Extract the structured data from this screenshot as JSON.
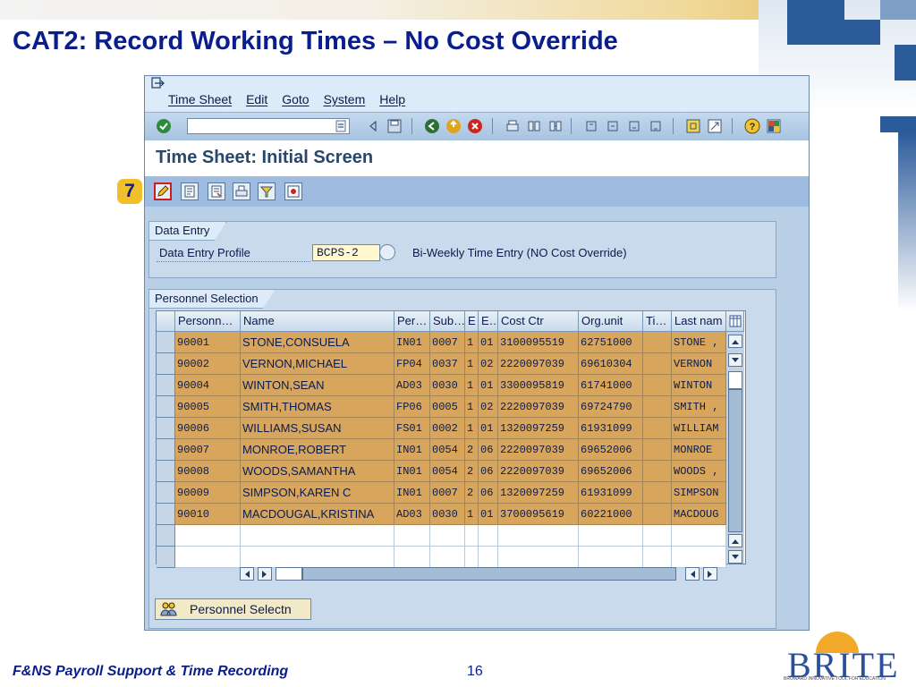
{
  "slide": {
    "title": "CAT2: Record Working Times – No Cost Override",
    "footer": "F&NS Payroll Support & Time Recording",
    "page": "16",
    "logo_text": "BRITE",
    "logo_tagline": "BROWARD INNOVATIVE TOOL FOR EDUCATION",
    "step_number": "7"
  },
  "sap": {
    "menu": [
      "Time Sheet",
      "Edit",
      "Goto",
      "System",
      "Help"
    ],
    "screen_title": "Time Sheet: Initial Screen",
    "data_entry": {
      "group_title": "Data Entry",
      "profile_label": "Data Entry Profile",
      "profile_value": "BCPS-2",
      "profile_desc": "Bi-Weekly Time Entry (NO Cost Override)"
    },
    "personnel": {
      "group_title": "Personnel Selection",
      "columns": [
        "Personn…",
        "Name",
        "Per…",
        "Sub…",
        "E",
        "E…",
        "Cost Ctr",
        "Org.unit",
        "Ti…",
        "Last nam"
      ],
      "rows": [
        [
          "90001",
          "STONE,CONSUELA",
          "IN01",
          "0007",
          "1",
          "01",
          "3100095519",
          "62751000",
          "",
          "STONE ,"
        ],
        [
          "90002",
          "VERNON,MICHAEL",
          "FP04",
          "0037",
          "1",
          "02",
          "2220097039",
          "69610304",
          "",
          "VERNON"
        ],
        [
          "90004",
          "WINTON,SEAN",
          "AD03",
          "0030",
          "1",
          "01",
          "3300095819",
          "61741000",
          "",
          "WINTON"
        ],
        [
          "90005",
          "SMITH,THOMAS",
          "FP06",
          "0005",
          "1",
          "02",
          "2220097039",
          "69724790",
          "",
          "SMITH ,"
        ],
        [
          "90006",
          "WILLIAMS,SUSAN",
          "FS01",
          "0002",
          "1",
          "01",
          "1320097259",
          "61931099",
          "",
          "WILLIAM"
        ],
        [
          "90007",
          "MONROE,ROBERT",
          "IN01",
          "0054",
          "2",
          "06",
          "2220097039",
          "69652006",
          "",
          "MONROE"
        ],
        [
          "90008",
          "WOODS,SAMANTHA",
          "IN01",
          "0054",
          "2",
          "06",
          "2220097039",
          "69652006",
          "",
          "WOODS ,"
        ],
        [
          "90009",
          "SIMPSON,KAREN C",
          "IN01",
          "0007",
          "2",
          "06",
          "1320097259",
          "61931099",
          "",
          "SIMPSON"
        ],
        [
          "90010",
          "MACDOUGAL,KRISTINA",
          "AD03",
          "0030",
          "1",
          "01",
          "3700095619",
          "60221000",
          "",
          "MACDOUG"
        ]
      ],
      "button_label": "Personnel Selectn"
    },
    "colors": {
      "row_highlight": "#d7a55c",
      "title_blue": "#0a1d8c"
    }
  }
}
